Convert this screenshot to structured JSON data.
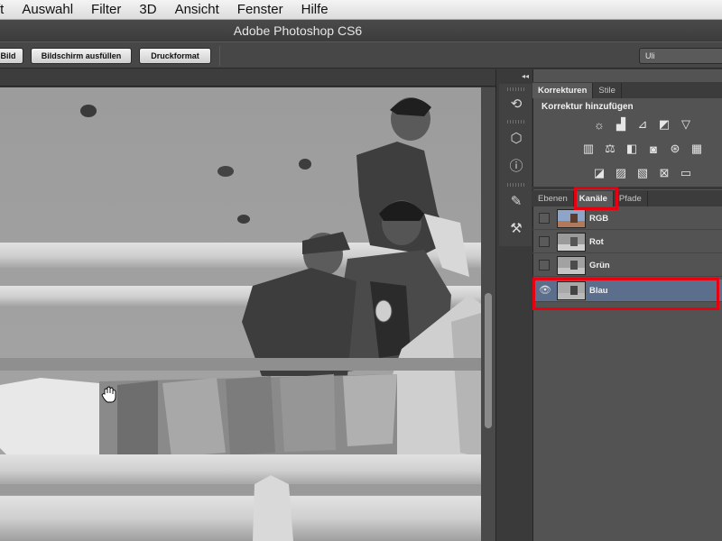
{
  "menubar": {
    "items": [
      "ft",
      "Auswahl",
      "Filter",
      "3D",
      "Ansicht",
      "Fenster",
      "Hilfe"
    ]
  },
  "window": {
    "title": "Adobe Photoshop CS6"
  },
  "options_bar": {
    "buttons": [
      "Bild",
      "Bildschirm ausfüllen",
      "Druckformat"
    ],
    "workspace": "Uli"
  },
  "adjustments_panel": {
    "tabs": [
      "Korrekturen",
      "Stile"
    ],
    "title": "Korrektur hinzufügen",
    "icons_row1": [
      "brightness-icon",
      "levels-icon",
      "curves-icon",
      "exposure-icon",
      "vibrance-icon"
    ],
    "icons_row2": [
      "hue-saturation-icon",
      "color-balance-icon",
      "black-white-icon",
      "photo-filter-icon",
      "channel-mixer-icon",
      "color-lookup-icon"
    ],
    "icons_row3": [
      "invert-icon",
      "posterize-icon",
      "threshold-icon",
      "selective-color-icon",
      "gradient-map-icon"
    ]
  },
  "layers_panel": {
    "tabs": [
      "Ebenen",
      "Kanäle",
      "Pfade"
    ],
    "active_tab": "Kanäle",
    "channels": [
      {
        "name": "RGB",
        "visible": false,
        "selected": false
      },
      {
        "name": "Rot",
        "visible": false,
        "selected": false
      },
      {
        "name": "Grün",
        "visible": false,
        "selected": false
      },
      {
        "name": "Blau",
        "visible": true,
        "selected": true
      }
    ]
  },
  "colors": {
    "highlight_red": "#e60010",
    "selected_row": "#5b6e8c",
    "panel_bg": "#535353"
  },
  "canvas": {
    "mode": "grayscale blue channel view",
    "cursor": "hand-tool-cursor"
  }
}
